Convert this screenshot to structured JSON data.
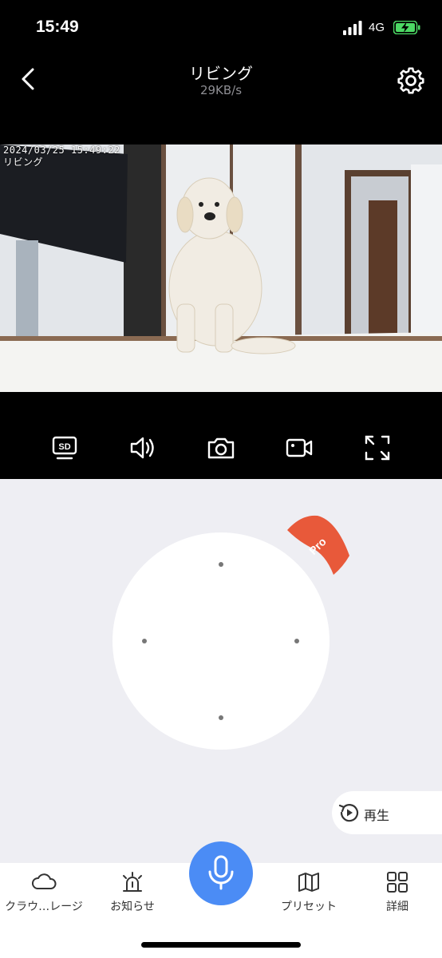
{
  "status_bar": {
    "time": "15:49",
    "network": "4G"
  },
  "nav": {
    "title": "リビング",
    "bitrate": "29KB/s"
  },
  "video": {
    "timestamp": "2024/03/25 15:49:22",
    "camera_label": "リビング"
  },
  "toolbar": {
    "items": [
      {
        "name": "sd-card",
        "icon": "sd-card-icon",
        "label": "SD"
      },
      {
        "name": "sound",
        "icon": "speaker-icon"
      },
      {
        "name": "snapshot",
        "icon": "camera-icon"
      },
      {
        "name": "record",
        "icon": "video-camera-icon"
      },
      {
        "name": "fullscreen",
        "icon": "fullscreen-icon"
      }
    ]
  },
  "ptz": {
    "badge": "Pro",
    "badge_color": "#e8593a"
  },
  "replay": {
    "label": "再生"
  },
  "tabs": {
    "cloud": "クラウ…レージ",
    "notifications": "お知らせ",
    "presets": "プリセット",
    "details": "詳細"
  },
  "colors": {
    "accent": "#4b8cf5",
    "battery": "#4cd964",
    "pro_badge": "#e8593a"
  }
}
